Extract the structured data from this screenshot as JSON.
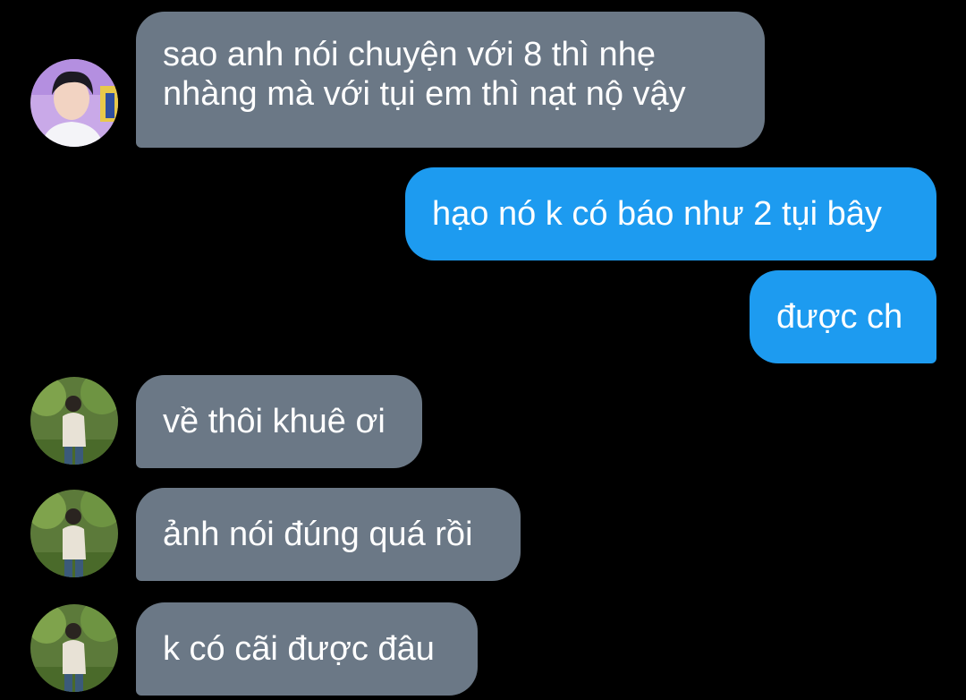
{
  "conversation": {
    "colors": {
      "background": "#000000",
      "incoming_bubble": "#6b7886",
      "outgoing_bubble": "#1d9bf0",
      "text": "#ffffff"
    },
    "messages": [
      {
        "direction": "incoming",
        "avatar": "avatar-photo-1",
        "lines": [
          "sao anh nói chuyện với 8 thì nhẹ",
          "nhàng mà với tụi em thì nạt nộ vậy"
        ]
      },
      {
        "direction": "outgoing",
        "lines": [
          "hạo nó k có báo như 2 tụi bây"
        ]
      },
      {
        "direction": "outgoing",
        "lines": [
          "được ch"
        ]
      },
      {
        "direction": "incoming",
        "avatar": "avatar-photo-2",
        "lines": [
          "về thôi khuê ơi"
        ]
      },
      {
        "direction": "incoming",
        "avatar": "avatar-photo-2",
        "lines": [
          "ảnh nói đúng quá rồi"
        ]
      },
      {
        "direction": "incoming",
        "avatar": "avatar-photo-2",
        "lines": [
          "k có cãi được đâu"
        ]
      }
    ]
  }
}
